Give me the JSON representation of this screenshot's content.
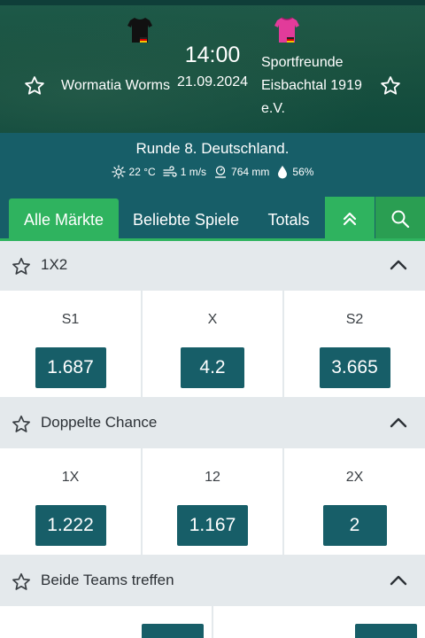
{
  "match": {
    "home_team": "Wormatia Worms",
    "away_team": "Sportfreunde Eisbachtal 1919 e.V.",
    "away_team_lines": [
      "Sportfreunde",
      "Eisbachtal 1919",
      "e.V."
    ],
    "time": "14:00",
    "date": "21.09.2024",
    "home_jersey_color": "#111111",
    "away_jersey_color": "#e23b9a"
  },
  "round": {
    "title": "Runde 8. Deutschland.",
    "weather": [
      {
        "icon": "sun-icon",
        "value": "22 °C"
      },
      {
        "icon": "wind-icon",
        "value": "1 m/s"
      },
      {
        "icon": "pressure-icon",
        "value": "764 mm"
      },
      {
        "icon": "humidity-icon",
        "value": "56%"
      }
    ]
  },
  "tabs": {
    "items": [
      "Alle Märkte",
      "Beliebte Spiele",
      "Totals"
    ],
    "active_index": 0
  },
  "markets": [
    {
      "title": "1X2",
      "outcomes": [
        {
          "label": "S1",
          "odds": "1.687"
        },
        {
          "label": "X",
          "odds": "4.2"
        },
        {
          "label": "S2",
          "odds": "3.665"
        }
      ]
    },
    {
      "title": "Doppelte Chance",
      "outcomes": [
        {
          "label": "1X",
          "odds": "1.222"
        },
        {
          "label": "12",
          "odds": "1.167"
        },
        {
          "label": "2X",
          "odds": "2"
        }
      ]
    },
    {
      "title": "Beide Teams treffen",
      "outcomes": []
    }
  ],
  "colors": {
    "accent_green": "#2fb35f",
    "teal": "#175e68",
    "odds_button": "#175e68"
  }
}
